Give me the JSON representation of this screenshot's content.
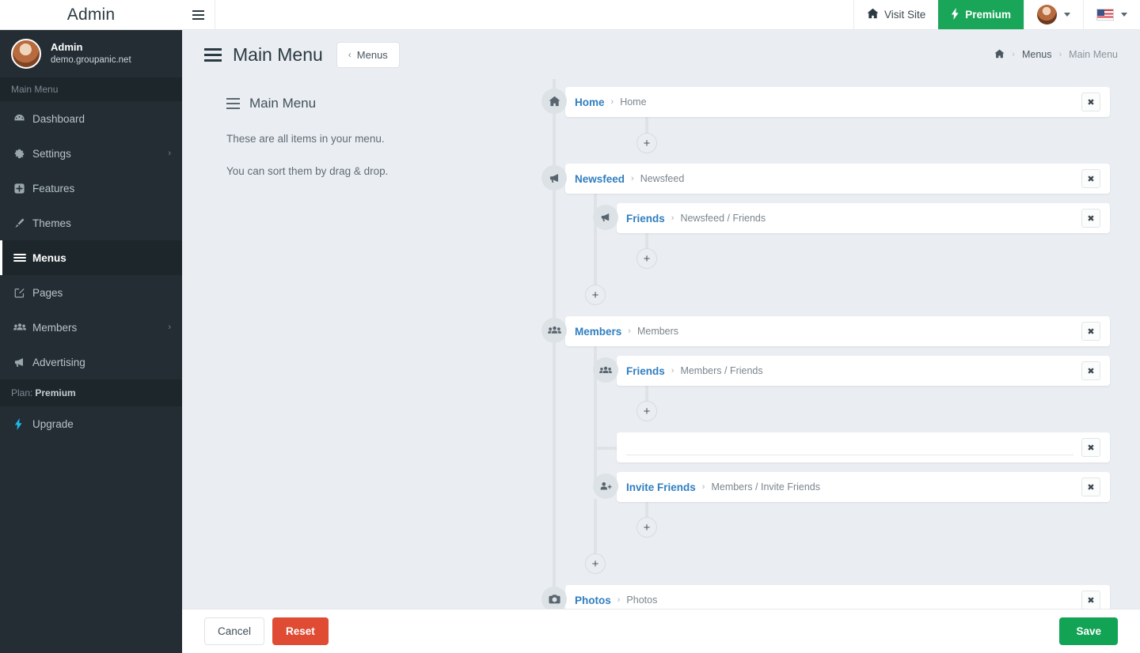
{
  "brand": {
    "title": "Admin"
  },
  "user": {
    "name": "Admin",
    "host": "demo.groupanic.net",
    "avatar_icon": "user-avatar"
  },
  "sidebar": {
    "heading": "Main Menu",
    "items": [
      {
        "label": "Dashboard",
        "icon": "dashboard-icon",
        "glyph": "◔",
        "caret": ""
      },
      {
        "label": "Settings",
        "icon": "gear-icon",
        "glyph": "⚙",
        "caret": "›"
      },
      {
        "label": "Features",
        "icon": "plus-square-icon",
        "glyph": "⊞",
        "caret": ""
      },
      {
        "label": "Themes",
        "icon": "brush-icon",
        "glyph": "✐",
        "caret": ""
      },
      {
        "label": "Menus",
        "icon": "hamburger-icon",
        "glyph": "≡",
        "caret": ""
      },
      {
        "label": "Pages",
        "icon": "edit-square-icon",
        "glyph": "✎",
        "caret": ""
      },
      {
        "label": "Members",
        "icon": "users-icon",
        "glyph": "⛭",
        "caret": "›"
      },
      {
        "label": "Advertising",
        "icon": "megaphone-icon",
        "glyph": "ᴘ",
        "caret": ""
      }
    ],
    "active_index": 4,
    "plan_label": "Plan:",
    "plan_value": "Premium",
    "upgrade": {
      "label": "Upgrade",
      "icon": "bolt-icon",
      "glyph": "⚡"
    }
  },
  "topbar": {
    "toggle_icon": "hamburger-toggle-icon",
    "visit_site": {
      "label": "Visit Site",
      "icon": "home-icon"
    },
    "premium": {
      "label": "Premium",
      "icon": "bolt-icon"
    },
    "account": {
      "icon": "user-avatar"
    },
    "language": {
      "icon": "us-flag-icon"
    }
  },
  "page": {
    "title": "Main Menu",
    "menus_button": "Menus",
    "back_icon": "chevron-left-icon",
    "breadcrumb": {
      "home_icon": "home-icon",
      "items": [
        "Menus",
        "Main Menu"
      ],
      "separator": "›"
    }
  },
  "panel": {
    "title": "Main Menu",
    "title_icon": "hamburger-icon",
    "line1": "These are all items in your menu.",
    "line2": "You can sort them by drag & drop."
  },
  "tree": {
    "remove_icon": "close-icon",
    "remove_glyph": "✖",
    "add_icon": "plus-icon",
    "add_glyph": "+",
    "separator": "›",
    "blank_placeholder": "",
    "blank_value": "",
    "rows": [
      {
        "label": "Home",
        "path": "Home",
        "icon": "home-icon",
        "glyph": "⌂",
        "level": 0
      },
      {
        "label": "Newsfeed",
        "path": "Newsfeed",
        "icon": "megaphone-icon",
        "glyph": "ᴘ",
        "level": 0
      },
      {
        "label": "Friends",
        "path": "Newsfeed / Friends",
        "icon": "megaphone-icon",
        "glyph": "ᴘ",
        "level": 1
      },
      {
        "label": "Members",
        "path": "Members",
        "icon": "users-icon",
        "glyph": "⛭",
        "level": 0
      },
      {
        "label": "Friends",
        "path": "Members / Friends",
        "icon": "users-icon",
        "glyph": "⛭",
        "level": 1
      },
      {
        "label": "",
        "path": "",
        "icon": "blank-input-icon",
        "glyph": "",
        "level": 1,
        "blank": true
      },
      {
        "label": "Invite Friends",
        "path": "Members / Invite Friends",
        "icon": "user-add-icon",
        "glyph": "☺",
        "level": 1
      },
      {
        "label": "Photos",
        "path": "Photos",
        "icon": "camera-icon",
        "glyph": "◉",
        "level": 0
      }
    ]
  },
  "footer": {
    "cancel": "Cancel",
    "reset": "Reset",
    "save": "Save"
  },
  "colors": {
    "sidebar_bg": "#232d33",
    "page_bg": "#eaeef2",
    "link_blue": "#2f7ec0",
    "premium_green": "#1aa659",
    "save_green": "#12a355",
    "reset_red": "#e04b33",
    "upgrade_cyan": "#20b7e8"
  }
}
